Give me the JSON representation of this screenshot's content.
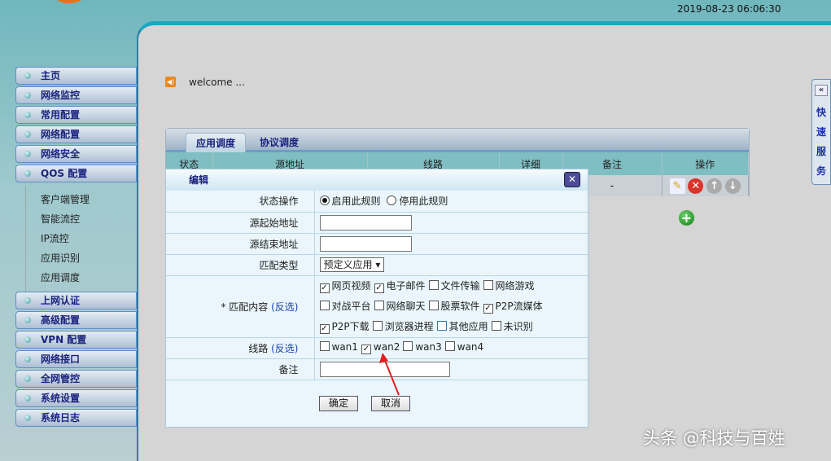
{
  "header": {
    "date": "2019-08-23 06:06:30"
  },
  "sidebar": {
    "items": [
      {
        "label": "主页"
      },
      {
        "label": "网络监控"
      },
      {
        "label": "常用配置"
      },
      {
        "label": "网络配置"
      },
      {
        "label": "网络安全"
      },
      {
        "label": "QOS 配置"
      },
      {
        "label": "上网认证"
      },
      {
        "label": "高级配置"
      },
      {
        "label": "VPN 配置"
      },
      {
        "label": "网络接口"
      },
      {
        "label": "全网管控"
      },
      {
        "label": "系统设置"
      },
      {
        "label": "系统日志"
      }
    ],
    "sub_items": [
      {
        "label": "客户端管理"
      },
      {
        "label": "智能流控"
      },
      {
        "label": "IP流控"
      },
      {
        "label": "应用识别"
      },
      {
        "label": "应用调度"
      }
    ]
  },
  "welcome": "welcome ...",
  "tabs": [
    {
      "label": "应用调度",
      "active": true
    },
    {
      "label": "协议调度"
    }
  ],
  "table": {
    "columns": [
      "状态",
      "源地址",
      "线路",
      "详细",
      "备注",
      "操作"
    ],
    "rows": [
      {
        "note": "-"
      }
    ]
  },
  "quick_service": {
    "arrow": "«",
    "label": [
      "快",
      "速",
      "服",
      "务"
    ]
  },
  "dialog": {
    "title": "编辑",
    "close": "✕",
    "state": {
      "label": "状态操作",
      "options": [
        {
          "label": "启用此规则",
          "selected": true
        },
        {
          "label": "停用此规则",
          "selected": false
        }
      ]
    },
    "src_start": {
      "label": "源起始地址",
      "value": ""
    },
    "src_end": {
      "label": "源结束地址",
      "value": ""
    },
    "match_type": {
      "label": "匹配类型",
      "value": "预定义应用"
    },
    "match_content": {
      "label": "* 匹配内容",
      "invert": "(反选)",
      "options": [
        {
          "label": "网页视频",
          "checked": true
        },
        {
          "label": "电子邮件",
          "checked": true
        },
        {
          "label": "文件传输",
          "checked": false
        },
        {
          "label": "网络游戏",
          "checked": false
        },
        {
          "label": "对战平台",
          "checked": false
        },
        {
          "label": "网络聊天",
          "checked": false
        },
        {
          "label": "股票软件",
          "checked": false
        },
        {
          "label": "P2P流媒体",
          "checked": true
        },
        {
          "label": "P2P下载",
          "checked": true
        },
        {
          "label": "浏览器进程",
          "checked": false
        },
        {
          "label": "其他应用",
          "checked": false
        },
        {
          "label": "未识别",
          "checked": false
        }
      ]
    },
    "line": {
      "label": "线路",
      "invert": "(反选)",
      "options": [
        {
          "label": "wan1",
          "checked": false
        },
        {
          "label": "wan2",
          "checked": true
        },
        {
          "label": "wan3",
          "checked": false
        },
        {
          "label": "wan4",
          "checked": false
        }
      ]
    },
    "note": {
      "label": "备注",
      "value": ""
    },
    "ok": "确定",
    "cancel": "取消"
  },
  "watermark": "头条 @科技与百姓"
}
